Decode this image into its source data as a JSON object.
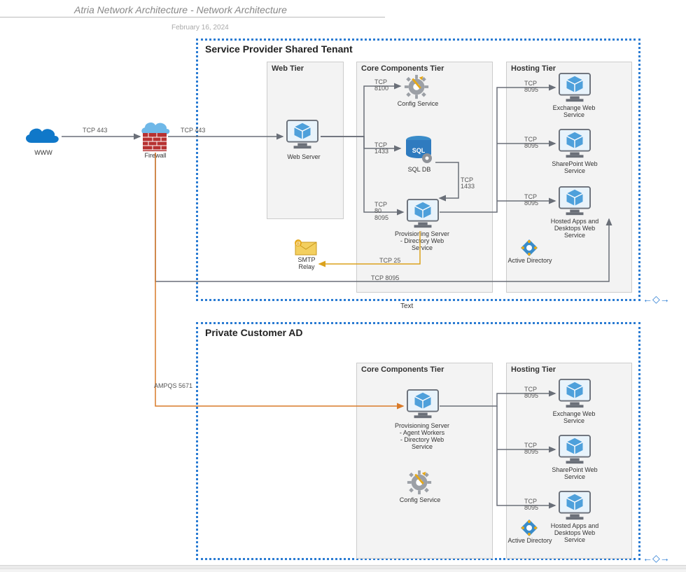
{
  "header": {
    "title": "Atria Network Architecture - Network Architecture",
    "date": "February 16, 2024"
  },
  "regions": {
    "sp": {
      "title": "Service Provider Shared Tenant",
      "body_text": "Text"
    },
    "customer": {
      "title": "Private Customer AD"
    }
  },
  "tiers": {
    "web": {
      "title": "Web Tier"
    },
    "core_sp": {
      "title": "Core Components Tier"
    },
    "hosting_sp": {
      "title": "Hosting Tier"
    },
    "core_cust": {
      "title": "Core Components Tier"
    },
    "hosting_cust": {
      "title": "Hosting Tier"
    }
  },
  "nodes": {
    "www": {
      "label": "WWW"
    },
    "firewall": {
      "label": "Firewall"
    },
    "web_server": {
      "label": "Web Server"
    },
    "config_service": {
      "label": "Config Service"
    },
    "sql_db": {
      "label": "SQL DB"
    },
    "prov_sp": {
      "label": "Provisioning Server\n- Directory Web\nService"
    },
    "smtp": {
      "label": "SMTP\nRelay"
    },
    "exchange_sp": {
      "label": "Exchange Web\nService"
    },
    "sharepoint_sp": {
      "label": "SharePoint Web\nService"
    },
    "hosted_sp": {
      "label": "Hosted Apps and\nDesktops Web\nService"
    },
    "ad_sp": {
      "label": "Active Directory"
    },
    "prov_cust": {
      "label": "Provisioning Server\n- Agent Workers\n- Directory Web\nService"
    },
    "config_cust": {
      "label": "Config Service"
    },
    "exchange_cust": {
      "label": "Exchange Web\nService"
    },
    "sharepoint_cust": {
      "label": "SharePoint Web\nService"
    },
    "hosted_cust": {
      "label": "Hosted Apps and\nDesktops Web\nService"
    },
    "ad_cust": {
      "label": "Active Directory"
    }
  },
  "connections": {
    "www_fw": {
      "port": "TCP 443"
    },
    "fw_web": {
      "port": "TCP 443"
    },
    "web_config": {
      "port": "TCP\n8100"
    },
    "web_sql": {
      "port": "TCP\n1433"
    },
    "web_prov": {
      "port": "TCP\n80\n8095"
    },
    "sql_prov": {
      "port": "TCP\n1433"
    },
    "prov_smtp": {
      "port": "TCP 25"
    },
    "prov_exchange": {
      "port": "TCP\n8095"
    },
    "prov_sharepoint": {
      "port": "TCP\n8095"
    },
    "prov_hosted": {
      "port": "TCP\n8095"
    },
    "fw_hosting": {
      "port": "TCP 8095"
    },
    "fw_cust": {
      "port": "AMPQS 5671"
    },
    "cust_exchange": {
      "port": "TCP\n8095"
    },
    "cust_sharepoint": {
      "port": "TCP\n8095"
    },
    "cust_hosted": {
      "port": "TCP\n8095"
    }
  },
  "icons": {
    "cloud_blue": "cloud-icon",
    "cloud_light": "cloud-icon",
    "firewall": "firewall-icon",
    "monitor": "monitor-icon",
    "gear": "gear-icon",
    "sql": "sql-icon",
    "envelope": "envelope-icon",
    "ad": "active-directory-icon",
    "resize": "resize-handle-icon"
  },
  "colors": {
    "region_border": "#2b7cd3",
    "tier_bg": "#f3f3f3",
    "cloud_blue": "#1078c9",
    "cloud_light": "#6fb8e8",
    "firewall_brick": "#b73131",
    "monitor_frame": "#6a6f78",
    "monitor_screen": "#e8f3fb",
    "cube": "#4ea0db",
    "sql": "#2f7bbf",
    "gold": "#e6a817",
    "smtp_line": "#dba21c",
    "ampqs_line": "#d97a29",
    "line_gray": "#6a6f78"
  }
}
